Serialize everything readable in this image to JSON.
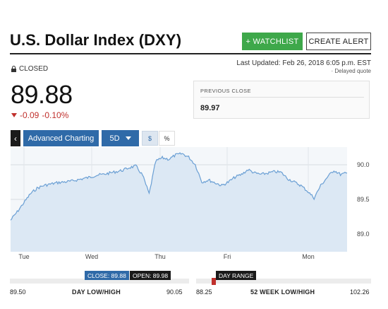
{
  "header": {
    "title": "U.S. Dollar Index (DXY)",
    "watchlist_label": "+ WATCHLIST",
    "alert_label": "CREATE ALERT"
  },
  "status": {
    "label": "CLOSED",
    "updated": "Last Updated: Feb 26, 2018 6:05 p.m. EST",
    "delayed": "· Delayed quote"
  },
  "quote": {
    "price": "89.88",
    "change": "-0.09",
    "change_pct": "-0.10%",
    "previous_close_label": "PREVIOUS CLOSE",
    "previous_close": "89.97"
  },
  "toolbar": {
    "back": "‹",
    "advanced": "Advanced Charting",
    "period": "5D",
    "usd": "$",
    "pct": "%"
  },
  "chart_data": {
    "type": "area",
    "x_ticks": [
      "Tue",
      "Wed",
      "Thu",
      "Fri",
      "Mon"
    ],
    "y_ticks": [
      "90.0",
      "89.5",
      "89.0"
    ],
    "ylim": [
      89.0,
      90.0
    ],
    "grid": true,
    "series": [
      {
        "values": [
          89.2,
          89.32,
          89.45,
          89.58,
          89.66,
          89.7,
          89.72,
          89.74,
          89.75,
          89.76,
          89.78,
          89.8,
          89.82,
          89.85,
          89.86,
          89.88,
          89.9,
          89.92,
          89.96,
          89.98,
          89.85,
          89.58,
          90.05,
          90.1,
          90.08,
          90.14,
          90.16,
          90.11,
          90.0,
          89.75,
          89.78,
          89.74,
          89.7,
          89.75,
          89.82,
          89.86,
          89.93,
          89.88,
          89.86,
          89.88,
          89.9,
          89.89,
          89.8,
          89.75,
          89.7,
          89.62,
          89.52,
          89.7,
          89.82,
          89.92,
          89.86,
          89.88
        ]
      }
    ],
    "colors": {
      "line": "#6a9fd4",
      "fill": "#dce8f4"
    }
  },
  "ranges": {
    "day": {
      "low": "89.50",
      "high": "90.05",
      "label": "DAY LOW/HIGH",
      "close_tag": "CLOSE: 89.88",
      "open_tag": "OPEN: 89.98"
    },
    "week52": {
      "low": "88.25",
      "high": "102.26",
      "label": "52 WEEK LOW/HIGH",
      "range_tag": "DAY RANGE"
    }
  }
}
